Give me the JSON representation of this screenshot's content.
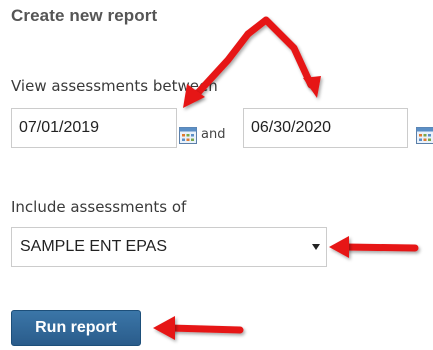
{
  "title": "Create new report",
  "date_range": {
    "label": "View assessments between",
    "start": "07/01/2019",
    "and_label": "and",
    "end": "06/30/2020"
  },
  "include": {
    "label": "Include assessments of",
    "selected": "SAMPLE ENT EPAS"
  },
  "run_button_label": "Run report",
  "icons": {
    "calendar": "calendar-icon",
    "dropdown": "chevron-down-icon",
    "annotation": "red-arrow"
  },
  "colors": {
    "primary_button": "#2a5c8b",
    "annotation_arrow": "#e61919",
    "input_border": "#cccccc"
  }
}
